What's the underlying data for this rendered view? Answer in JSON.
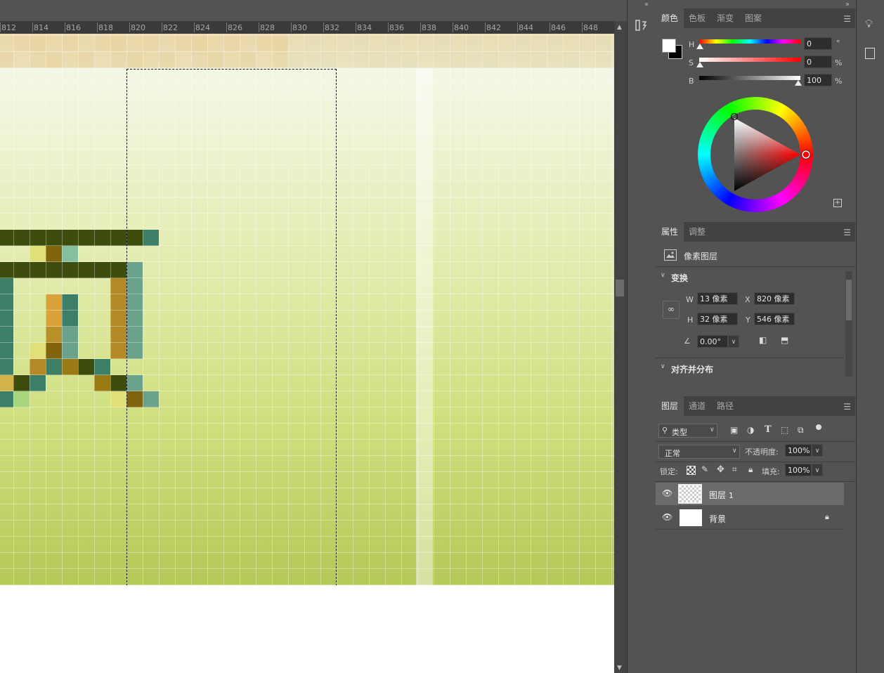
{
  "ruler": {
    "ticks": [
      "812",
      "814",
      "816",
      "818",
      "820",
      "822",
      "824",
      "826",
      "828",
      "830",
      "832",
      "834",
      "836",
      "838",
      "840",
      "842",
      "844",
      "846",
      "848"
    ]
  },
  "color_panel": {
    "tabs": [
      "颜色",
      "色板",
      "渐变",
      "图案"
    ],
    "h_label": "H",
    "h_value": "0",
    "h_unit": "°",
    "s_label": "S",
    "s_value": "0",
    "s_unit": "%",
    "b_label": "B",
    "b_value": "100",
    "b_unit": "%",
    "foreground": "#ffffff",
    "background": "#000000"
  },
  "properties_panel": {
    "tabs": [
      "属性",
      "调整"
    ],
    "layer_type": "像素图层",
    "transform_title": "变换",
    "w_label": "W",
    "w_value": "13 像素",
    "h_label": "H",
    "h_value": "32 像素",
    "x_label": "X",
    "x_value": "820 像素",
    "y_label": "Y",
    "y_value": "546 像素",
    "angle_value": "0.00°",
    "align_title": "对齐并分布"
  },
  "layers_panel": {
    "tabs": [
      "图层",
      "通道",
      "路径"
    ],
    "filter_type": "类型",
    "blend_mode": "正常",
    "opacity_label": "不透明度:",
    "opacity_value": "100%",
    "lock_label": "锁定:",
    "fill_label": "填充:",
    "fill_value": "100%",
    "layers": [
      {
        "name": "图层",
        "suffix": "1",
        "selected": true
      },
      {
        "name": "背景",
        "suffix": "",
        "selected": false
      }
    ]
  },
  "colors": {
    "accent": "#e03a1a",
    "panel": "#535353",
    "tabbar": "#424242"
  }
}
